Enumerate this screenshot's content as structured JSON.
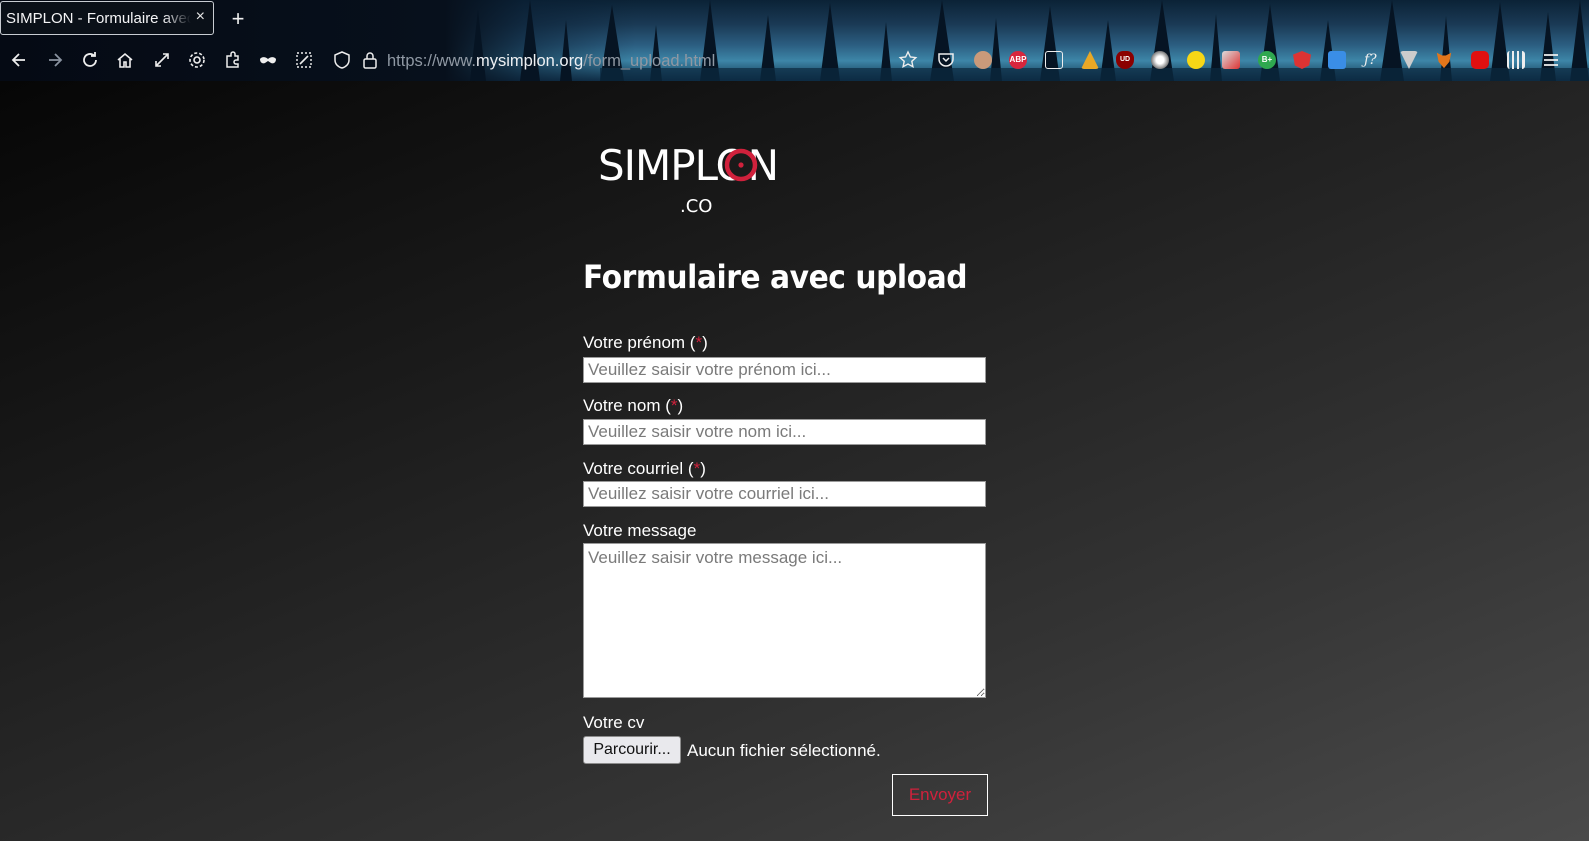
{
  "browser": {
    "tab_title": "SIMPLON - Formulaire avec upload",
    "tab_close": "×",
    "new_tab": "+",
    "url_prefix": "https://www.",
    "url_domain": "mysimplon.org",
    "url_path": "/form_upload.html",
    "extension_labels": [
      "ABP",
      "UD",
      "B+"
    ]
  },
  "logo": {
    "text": "SIMPLON",
    "suffix": ".CO",
    "accent_color": "#d0213c"
  },
  "page": {
    "heading": "Formulaire avec upload"
  },
  "form": {
    "prenom": {
      "label": "Votre prénom",
      "required_mark": "*",
      "placeholder": "Veuillez saisir votre prénom ici..."
    },
    "nom": {
      "label": "Votre nom",
      "required_mark": "*",
      "placeholder": "Veuillez saisir votre nom ici..."
    },
    "courriel": {
      "label": "Votre courriel",
      "required_mark": "*",
      "placeholder": "Veuillez saisir votre courriel ici..."
    },
    "message": {
      "label": "Votre message",
      "placeholder": "Veuillez saisir votre message ici..."
    },
    "cv": {
      "label": "Votre cv",
      "browse_button": "Parcourir...",
      "no_file_text": "Aucun fichier sélectionné."
    },
    "submit_label": "Envoyer"
  }
}
